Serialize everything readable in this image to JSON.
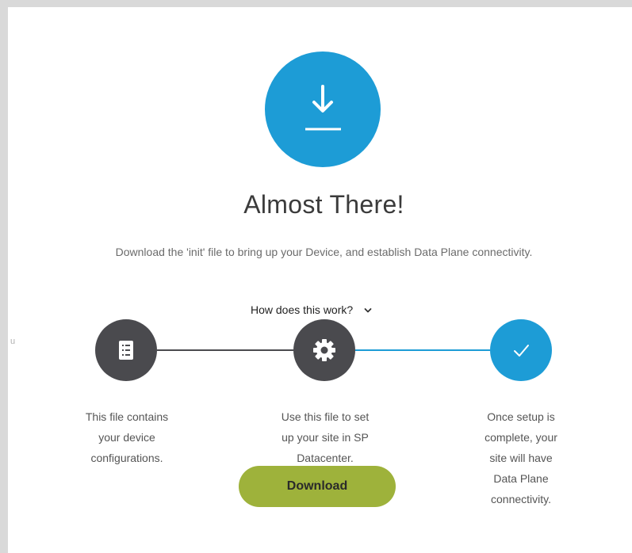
{
  "hero": {
    "title": "Almost There!",
    "subtitle": "Download the 'init' file to bring up your Device, and establish Data Plane connectivity.",
    "icon": "download-icon"
  },
  "toggle": {
    "label": "How does this work?",
    "icon": "chevron-down-icon"
  },
  "steps": [
    {
      "icon": "file-list-icon",
      "lines": [
        "This file contains",
        "your device",
        "configurations."
      ]
    },
    {
      "icon": "gear-icon",
      "lines": [
        "Use this file to set",
        "up your site in SP",
        "Datacenter."
      ]
    },
    {
      "icon": "checkmark-icon",
      "lines": [
        "Once setup is",
        "complete, your",
        "site will have",
        "Data Plane",
        "connectivity."
      ]
    }
  ],
  "download_button": {
    "label": "Download"
  },
  "edge_text": "u",
  "colors": {
    "accent_blue": "#1d9cd6",
    "dark_step": "#4a4a4e",
    "button_green": "#9eb23b"
  }
}
